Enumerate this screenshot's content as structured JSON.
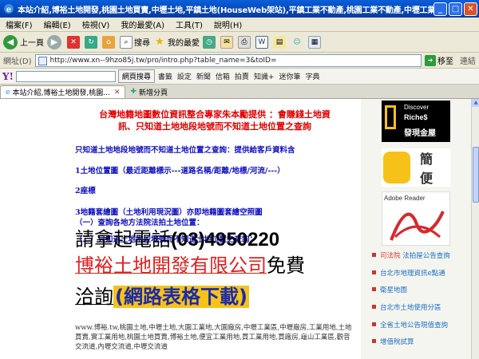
{
  "window": {
    "title": "本站介紹,博裕土地開發,桃園土地買賣,中壢土地,平鎮土地(HouseWeb架站),平鎮工業不動產,桃園工業不動產,中壢工業不動產,桃園房屋仲介 - Microsoft Internet E",
    "min": "_",
    "max": "□",
    "close": "✕"
  },
  "menu": [
    "檔案(F)",
    "編輯(E)",
    "檢視(V)",
    "我的最愛(A)",
    "工具(T)",
    "說明(H)"
  ],
  "toolbar": {
    "back": "上一頁",
    "search": "搜尋",
    "favorites": "我的最愛"
  },
  "address": {
    "label": "網址(D)",
    "url": "http://www.xn--9hzo85j.tw/pro/intro.php?table_name=3&toID=",
    "go": "移至",
    "links": "連結"
  },
  "yahoo": {
    "logo": "Y!",
    "search_btn": "網頁搜尋",
    "items": [
      "書籤",
      "設定",
      "新聞",
      "信箱",
      "拍賣",
      "知識+",
      "迷你筆",
      "字典"
    ]
  },
  "tabs": [
    {
      "label": "本站介紹,博裕土地開發,桃園..."
    },
    {
      "label": "新增分頁"
    }
  ],
  "main": {
    "headline1": "台灣地籍地圖數位資訊整合專家朱本勵提供 ：會賺錢土地資",
    "headline2": "訊、只知道土地地段地號而不知道土地位置之查詢",
    "l1": "只知道土地地段地號而不知道土地位置之查詢：提供給客戶資料含",
    "l2": "1土地位置圖（最近距離標示---道路名稱/距離/地標/河流/---）",
    "l3": "2座標",
    "l4": "3地籍套繪圖（土地利用現況圖）亦即地籍圖套繪空照圖",
    "l5": "（一）查詢各地方法院法拍土地位置：",
    "l6": "（二）只知道土地地段地號而不知道土地位置之查詢：",
    "phone_label": "請拿起電話",
    "phone": "(03)4950220",
    "company": "博裕土地開發有限公司",
    "free": "免費",
    "consult": "洽詢",
    "form_link": "(網路表格下載)",
    "footer": "www.博裕.tw,桃園土地,中壢土地,大園工業地,大園廠房,中壢工業區,中壢廠房,工業用地,土地買賣,實工業用地,桃園土地買賣,博裕土地,便宜工業用地,買工業用地,買廠房,龜山工業區,觀音交流道,內壢交流道,中壢交流道"
  },
  "sidebar": {
    "discover_line1": "Discover",
    "discover_line2": "Riche$",
    "discover_line3": "發現金屋",
    "promo_chars": "簡",
    "promo_chars2": "便",
    "adobe": "Adobe Reader",
    "links": [
      {
        "a": "司法院",
        "b": "法拍屋公告查詢"
      },
      {
        "a": "台北市地理資訊e點通",
        "b": ""
      },
      {
        "a": "衛星地圖",
        "b": ""
      },
      {
        "a": "台北市土地使用分區",
        "b": ""
      },
      {
        "a": "全省土地公告現值查詢",
        "b": ""
      },
      {
        "a": "增值稅試算",
        "b": ""
      }
    ]
  }
}
